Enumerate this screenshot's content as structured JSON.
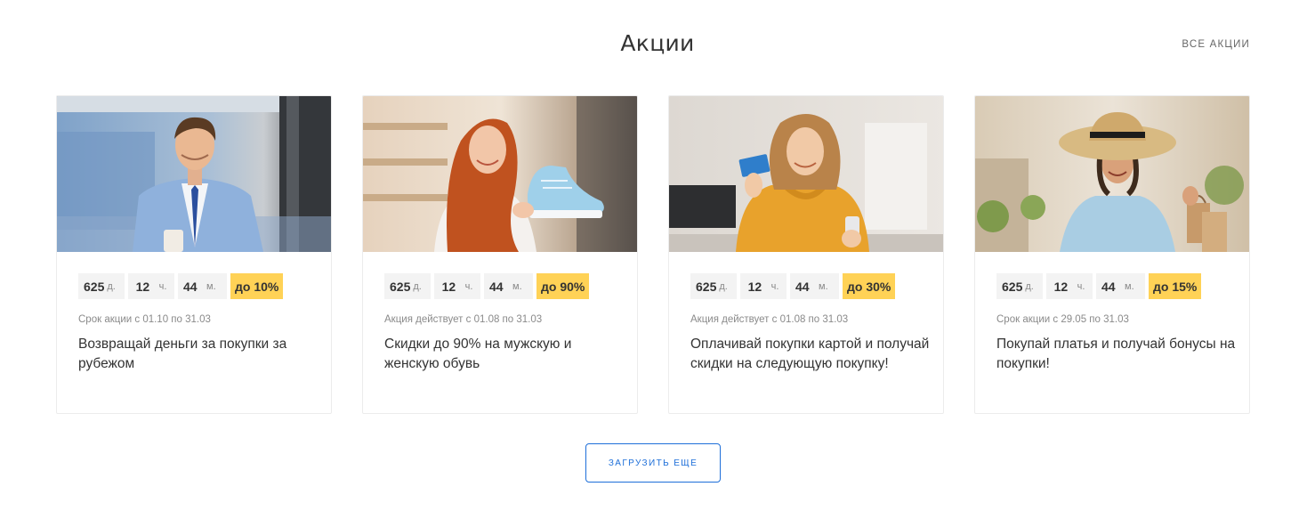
{
  "header": {
    "title": "Акции",
    "all_link": "ВСЕ АКЦИИ"
  },
  "cards": [
    {
      "image": "man-in-blue-suit-with-coffee-photo",
      "timer": {
        "days": "625",
        "days_unit": "д.",
        "hours": "12",
        "hours_unit": "ч.",
        "minutes": "44",
        "minutes_unit": "м."
      },
      "discount": "до 10%",
      "period": "Срок акции с 01.10 по 31.03",
      "description": "Возвращай деньги за покупки за рубежом"
    },
    {
      "image": "redhead-woman-holding-sneaker-photo",
      "timer": {
        "days": "625",
        "days_unit": "д.",
        "hours": "12",
        "hours_unit": "ч.",
        "minutes": "44",
        "minutes_unit": "м."
      },
      "discount": "до 90%",
      "period": "Акция действует с 01.08 по 31.03",
      "description": "Скидки до 90% на мужскую и женскую обувь"
    },
    {
      "image": "woman-in-yellow-sweater-with-card-photo",
      "timer": {
        "days": "625",
        "days_unit": "д.",
        "hours": "12",
        "hours_unit": "ч.",
        "minutes": "44",
        "minutes_unit": "м."
      },
      "discount": "до 30%",
      "period": "Акция действует с 01.08 по 31.03",
      "description": "Оплачивай покупки картой и получай скидки на следующую покупку!"
    },
    {
      "image": "woman-in-hat-with-shopping-bags-photo",
      "timer": {
        "days": "625",
        "days_unit": "д.",
        "hours": "12",
        "hours_unit": "ч.",
        "minutes": "44",
        "minutes_unit": "м."
      },
      "discount": "до 15%",
      "period": "Срок акции с 29.05 по 31.03",
      "description": "Покупай платья и получай бонусы на покупки!"
    }
  ],
  "load_more": "ЗАГРУЗИТЬ ЕЩЕ",
  "colors": {
    "badge": "#ffd256",
    "accent": "#1e6fd9",
    "timer_bg": "#f3f3f3"
  }
}
